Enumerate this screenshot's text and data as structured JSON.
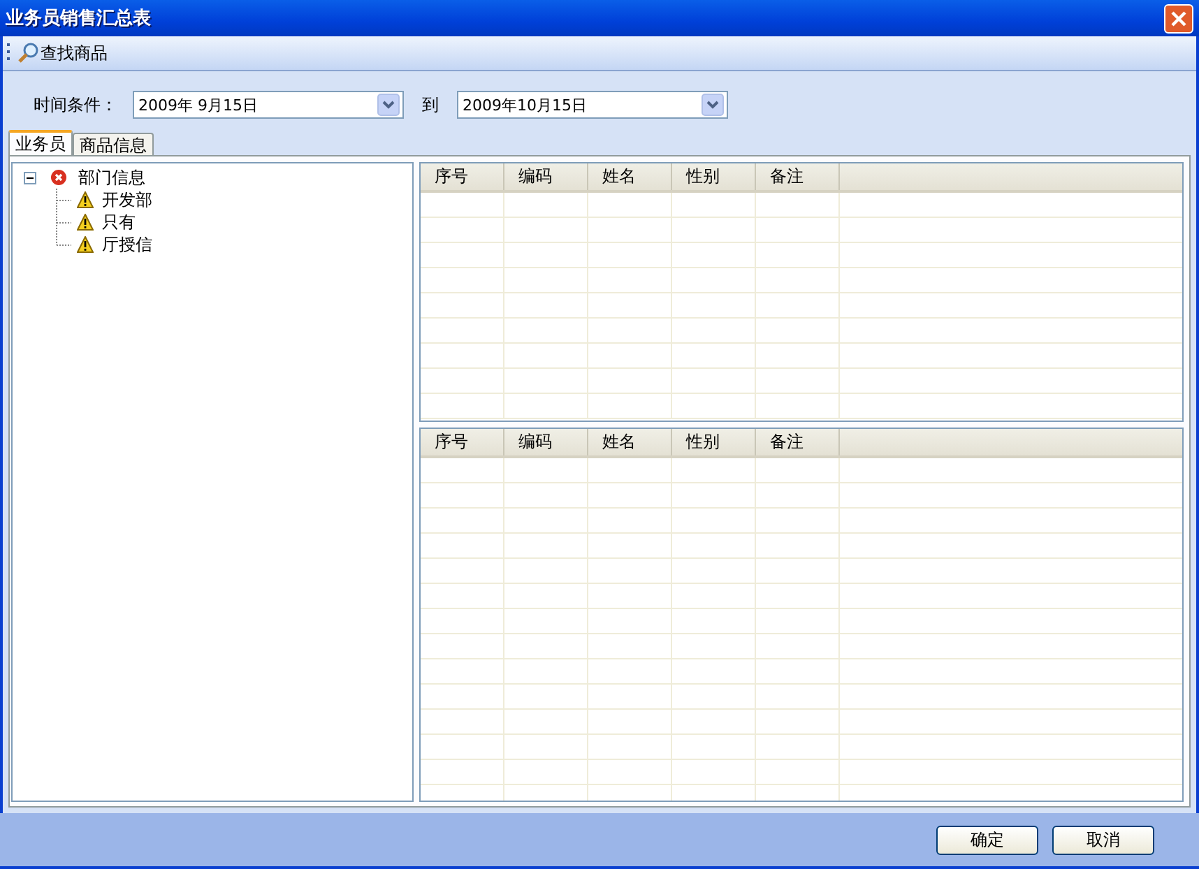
{
  "window": {
    "title": "业务员销售汇总表"
  },
  "toolbar": [
    {
      "label": "查找商品"
    }
  ],
  "filter": {
    "label": "时间条件：",
    "from": "2009年 9月15日",
    "separator": "到",
    "to": "2009年10月15日"
  },
  "tabs": [
    {
      "label": "业务员",
      "selected": true
    },
    {
      "label": "商品信息",
      "selected": false
    }
  ],
  "tree": [
    {
      "label": "部门信息",
      "kind": "error",
      "expanded": true,
      "children": [
        {
          "label": "开发部",
          "kind": "warning"
        },
        {
          "label": "只有",
          "kind": "warning"
        },
        {
          "label": "厅授信",
          "kind": "warning"
        }
      ]
    }
  ],
  "grids": [
    {
      "columns": [
        "序号",
        "编码",
        "姓名",
        "性别",
        "备注"
      ]
    },
    {
      "columns": [
        "序号",
        "编码",
        "姓名",
        "性别",
        "备注"
      ]
    }
  ],
  "buttons": [
    "确定",
    "取消"
  ]
}
